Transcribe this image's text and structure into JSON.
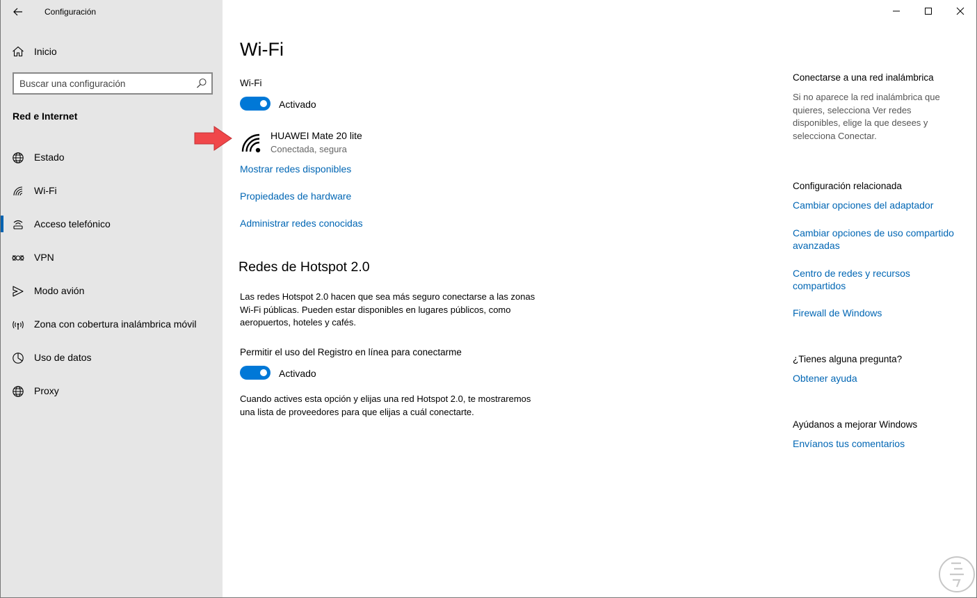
{
  "app": {
    "title": "Configuración"
  },
  "sidebar": {
    "home_label": "Inicio",
    "search_placeholder": "Buscar una configuración",
    "section_title": "Red e Internet",
    "items": [
      {
        "label": "Estado",
        "icon": "globe-icon",
        "active": false
      },
      {
        "label": "Wi-Fi",
        "icon": "wifi-icon",
        "active": true
      },
      {
        "label": "Acceso telefónico",
        "icon": "dialup-icon",
        "active": false
      },
      {
        "label": "VPN",
        "icon": "vpn-icon",
        "active": false
      },
      {
        "label": "Modo avión",
        "icon": "airplane-icon",
        "active": false
      },
      {
        "label": "Zona con cobertura inalámbrica móvil",
        "icon": "hotspot-icon",
        "active": false
      },
      {
        "label": "Uso de datos",
        "icon": "data-usage-icon",
        "active": false
      },
      {
        "label": "Proxy",
        "icon": "globe-icon",
        "active": false
      }
    ]
  },
  "main": {
    "title": "Wi-Fi",
    "wifi_label": "Wi-Fi",
    "wifi_toggle": "Activado",
    "network": {
      "name": "HUAWEI Mate 20 lite",
      "status": "Conectada, segura"
    },
    "links": {
      "show_networks": "Mostrar redes disponibles",
      "hardware": "Propiedades de hardware",
      "manage": "Administrar redes conocidas"
    },
    "hotspot": {
      "title": "Redes de Hotspot 2.0",
      "description_lines": [
        "Las redes Hotspot 2.0 hacen que sea más seguro conectarse a las zonas",
        "Wi-Fi públicas. Pueden estar disponibles en lugares públicos, como",
        "aeropuertos, hoteles y cafés."
      ],
      "registry_label": "Permitir el uso del Registro en línea para conectarme",
      "registry_toggle": "Activado",
      "note_lines": [
        "Cuando actives esta opción y elijas una red Hotspot 2.0, te mostraremos",
        "una lista de proveedores para que elijas a cuál conectarte."
      ]
    }
  },
  "side": {
    "connect_title": "Conectarse a una red inalámbrica",
    "connect_lines": [
      "Si no aparece la red inalámbrica que",
      "quieres, selecciona Ver redes",
      "disponibles, elige la que desees y",
      "selecciona Conectar."
    ],
    "related_title": "Configuración relacionada",
    "related_links": [
      [
        "Cambiar opciones del adaptador"
      ],
      [
        "Cambiar opciones de uso compartido",
        "avanzadas"
      ],
      [
        "Centro de redes y recursos",
        "compartidos"
      ],
      [
        "Firewall de Windows"
      ]
    ],
    "question_title": "¿Tienes alguna pregunta?",
    "help_link": "Obtener ayuda",
    "improve_title": "Ayúdanos a mejorar Windows",
    "feedback_link": "Envíanos tus comentarios"
  },
  "colors": {
    "accent": "#0078d7",
    "link": "#0066b4",
    "sidebar_bg": "#e6e6e6",
    "arrow": "#f0474a"
  }
}
